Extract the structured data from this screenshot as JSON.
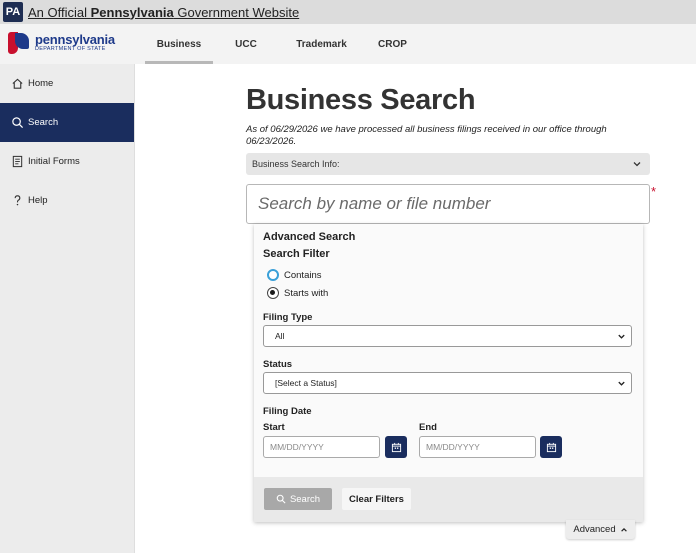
{
  "gov_bar": {
    "badge": "PA",
    "prefix": "An Official ",
    "state": "Pennsylvania",
    "suffix": " Government Website"
  },
  "logo": {
    "line1": "pennsylvania",
    "line2": "DEPARTMENT OF STATE"
  },
  "tabs": [
    {
      "label": "Business",
      "active": true
    },
    {
      "label": "UCC",
      "active": false
    },
    {
      "label": "Trademark",
      "active": false
    },
    {
      "label": "CROP",
      "active": false
    }
  ],
  "sidebar": {
    "items": [
      {
        "label": "Home",
        "icon": "home-icon",
        "active": false
      },
      {
        "label": "Search",
        "icon": "search-icon",
        "active": true
      },
      {
        "label": "Initial Forms",
        "icon": "forms-icon",
        "active": false
      },
      {
        "label": "Help",
        "icon": "help-icon",
        "active": false
      }
    ]
  },
  "main": {
    "title": "Business Search",
    "notice": "As of 06/29/2026 we have processed all business filings received in our office through 06/23/2026.",
    "info_bar": "Business Search Info:",
    "search_placeholder": "Search by name or file number",
    "required_mark": "*"
  },
  "advanced": {
    "title": "Advanced Search",
    "filter_title": "Search Filter",
    "filter_options": [
      {
        "label": "Contains",
        "checked": false
      },
      {
        "label": "Starts with",
        "checked": true
      }
    ],
    "filing_type_label": "Filing Type",
    "filing_type_value": "All",
    "status_label": "Status",
    "status_value": "[Select a Status]",
    "filing_date_label": "Filing Date",
    "start_label": "Start",
    "end_label": "End",
    "date_placeholder": "MM/DD/YYYY",
    "search_button": "Search",
    "clear_button": "Clear Filters",
    "toggle_label": "Advanced"
  },
  "colors": {
    "navy": "#1a2d5e",
    "brand_red": "#c8102e",
    "radio_focus": "#3aa0d8"
  }
}
